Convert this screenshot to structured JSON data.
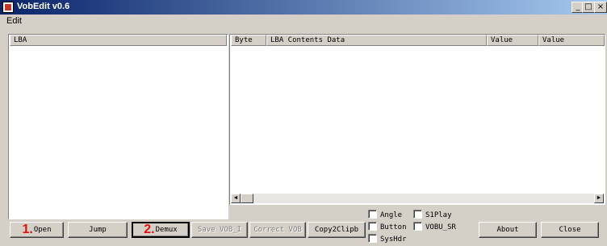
{
  "window": {
    "title": "VobEdit v0.6",
    "minimize": "_",
    "maximize": "□",
    "close": "×"
  },
  "menu": {
    "edit": "Edit"
  },
  "left_panel": {
    "header": "LBA"
  },
  "right_panel": {
    "columns": [
      "Byte",
      "LBA Contents Data",
      "Value",
      "Value"
    ]
  },
  "scroll": {
    "left": "◄",
    "right": "►"
  },
  "buttons": {
    "open_step": "1.",
    "open": "Open",
    "jump": "Jump",
    "demux_step": "2.",
    "demux": "Demux",
    "save_vob": "Save VOB_I",
    "correct_vob": "Correct VOB",
    "copy2clipb": "Copy2Clipb",
    "about": "About",
    "close": "Close"
  },
  "checkboxes": {
    "angle": "Angle",
    "button": "Button",
    "syshdr": "SysHdr",
    "s1play": "S1Play",
    "vobu_sr": "VOBU_SR"
  }
}
